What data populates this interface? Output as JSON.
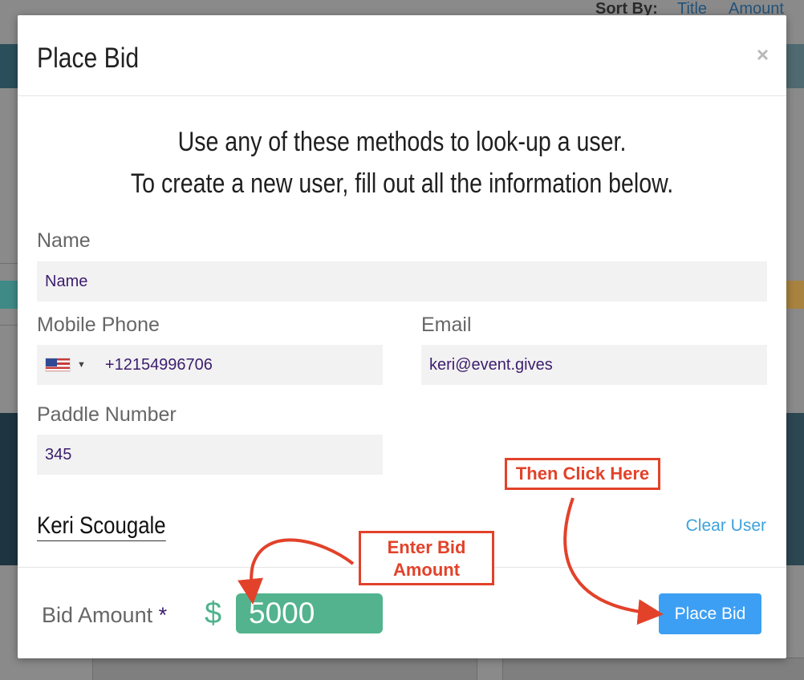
{
  "background": {
    "sort_label": "Sort By:",
    "sort_title": "Title",
    "sort_amount": "Amount"
  },
  "modal": {
    "title": "Place Bid",
    "close_glyph": "×",
    "instructions": [
      "Use any of these methods to look-up a user.",
      "To create a new user, fill out all the information below."
    ],
    "name": {
      "label": "Name",
      "value": "Name"
    },
    "phone": {
      "label": "Mobile Phone",
      "country": "US",
      "value": "+12154996706"
    },
    "email": {
      "label": "Email",
      "value": "keri@event.gives"
    },
    "paddle": {
      "label": "Paddle Number",
      "value": "345"
    },
    "selected_user": "Keri Scougale",
    "clear_user": "Clear User",
    "bid": {
      "label": "Bid Amount",
      "required_mark": "*",
      "currency": "$",
      "value": "5000"
    },
    "submit": "Place Bid"
  },
  "annotations": {
    "enter_bid_line1": "Enter Bid",
    "enter_bid_line2": "Amount",
    "then_click": "Then Click Here",
    "color": "#e2422a"
  },
  "colors": {
    "accent_green": "#52b38e",
    "button_blue": "#3d9ff3",
    "link_blue": "#3ea2dc",
    "field_text": "#3c1d6e"
  }
}
